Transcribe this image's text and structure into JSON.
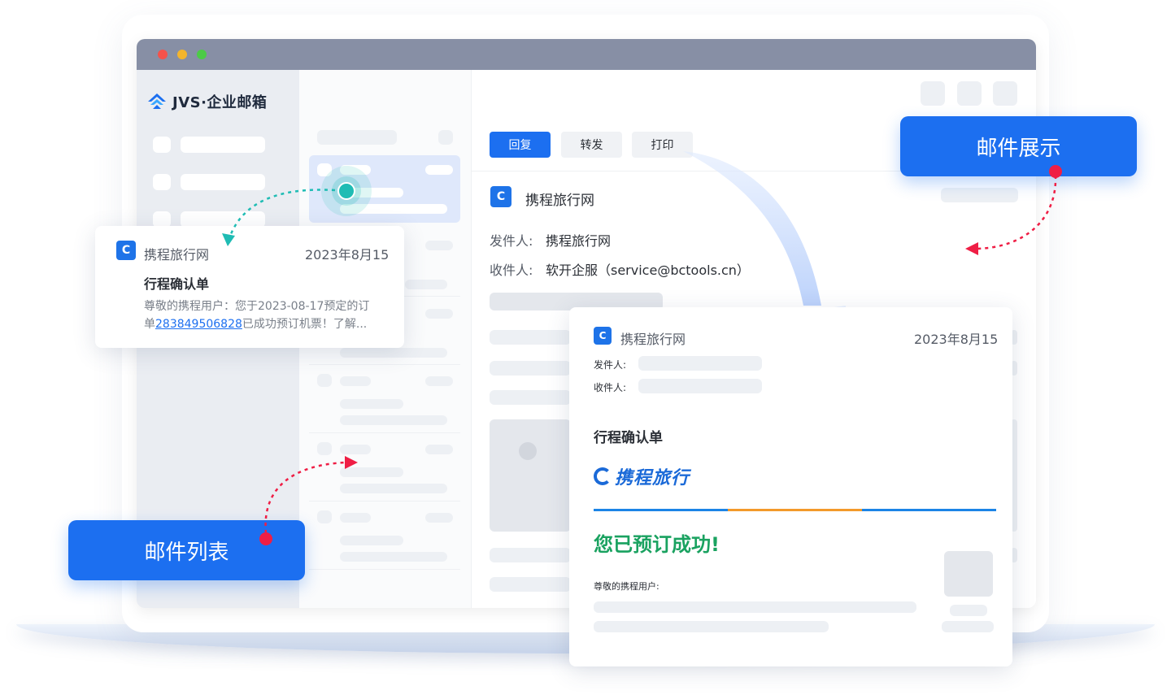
{
  "app": {
    "title": "JVS·企业邮箱"
  },
  "toolbar": {
    "reply": "回复",
    "forward": "转发",
    "print": "打印"
  },
  "email": {
    "sender_name": "携程旅行网",
    "from_label": "发件人:",
    "from_value": "携程旅行网",
    "to_label": "收件人:",
    "to_value": "软开企服（service@bctools.cn）"
  },
  "preview_card": {
    "sender": "携程旅行网",
    "date": "2023年8月15",
    "subject": "行程确认单",
    "body_line1": "尊敬的携程用户：您于2023-08-17预定的订",
    "body_prefix": "单",
    "order_link": "283849506828",
    "body_suffix": "已成功预订机票！了解..."
  },
  "detail_card": {
    "sender": "携程旅行网",
    "date": "2023年8月15",
    "from_label": "发件人:",
    "to_label": "收件人:",
    "subject": "行程确认单",
    "brand": "携程旅行",
    "headline": "您已预订成功!",
    "greeting": "尊敬的携程用户:"
  },
  "labels": {
    "mail_display": "邮件展示",
    "mail_list": "邮件列表"
  },
  "colors": {
    "primary": "#1c6ff0",
    "titlebar": "#878fa5",
    "success": "#1aa260",
    "pin": "#ef1e45",
    "connector": "#1fbcb4"
  },
  "icons": {
    "logo": "jvs-logo-icon",
    "app": "ctrip-dolphin-icon"
  }
}
